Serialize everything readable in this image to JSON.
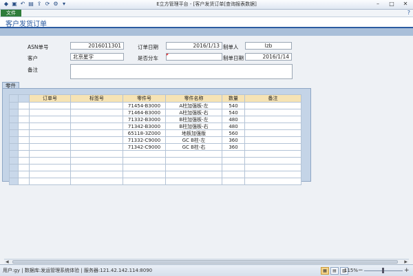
{
  "window": {
    "title": "E立方管理平台 - [客户发货订单[查询报表数据]",
    "quick_access_icons": [
      "app-logo-icon",
      "save-icon",
      "undo-icon",
      "print-icon",
      "export-icon",
      "refresh-icon",
      "settings-icon",
      "dropdown-icon"
    ]
  },
  "ribbon": {
    "file_tab": "文件",
    "help_icon": "help-icon"
  },
  "form": {
    "title": "客户发货订单",
    "asn_label": "ASN单号",
    "asn_value": "2016011301",
    "order_date_label": "订单日期",
    "order_date_value": "2016/1/13",
    "creator_label": "制单人",
    "creator_value": "lzb",
    "customer_label": "客户",
    "customer_value": "北京星宇",
    "split_label": "是否分车",
    "split_value": "",
    "create_date_label": "制单日期",
    "create_date_value": "2016/1/14",
    "remark_label": "备注",
    "remark_value": ""
  },
  "parts": {
    "tab_label": "零件",
    "headers": [
      "订单号",
      "标签号",
      "零件号",
      "零件名称",
      "数量",
      "备注"
    ],
    "rows": [
      [
        "",
        "",
        "71454-B3000",
        "A柱加强板-左",
        "540",
        ""
      ],
      [
        "",
        "",
        "71464-B3000",
        "A柱加强板-右",
        "540",
        ""
      ],
      [
        "",
        "",
        "71332-B3000",
        "B柱加强板-左",
        "480",
        ""
      ],
      [
        "",
        "",
        "71342-B3000",
        "B柱加强板-右",
        "480",
        ""
      ],
      [
        "",
        "",
        "65118-3Z000",
        "地板加强版",
        "560",
        ""
      ],
      [
        "",
        "",
        "71332-C9000",
        "GC B柱-左",
        "360",
        ""
      ],
      [
        "",
        "",
        "71342-C9000",
        "GC B柱-右",
        "360",
        ""
      ],
      [
        "",
        "",
        "",
        "",
        "",
        ""
      ],
      [
        "",
        "",
        "",
        "",
        "",
        ""
      ],
      [
        "",
        "",
        "",
        "",
        "",
        ""
      ],
      [
        "",
        "",
        "",
        "",
        "",
        ""
      ],
      [
        "",
        "",
        "",
        "",
        "",
        ""
      ]
    ]
  },
  "status_bar": {
    "text": "用户:gy | 数据库:发运管理系统体验 | 服务器:121.42.142.114:8090",
    "zoom": "115%"
  }
}
